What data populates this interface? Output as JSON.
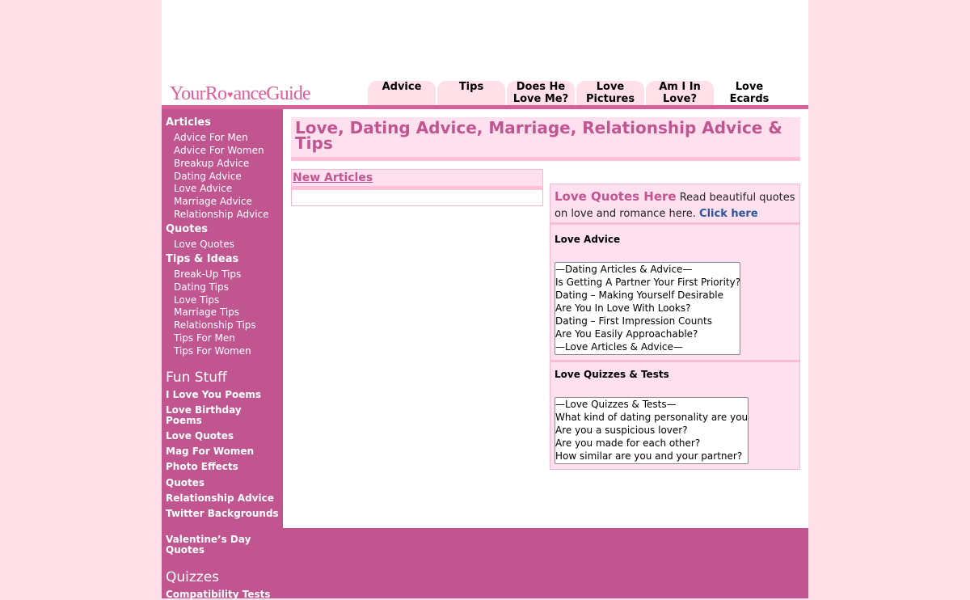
{
  "site": {
    "logo_part1": "YourRomanceGuide",
    "logo_heart": "♥"
  },
  "tabs": [
    {
      "label": "Advice"
    },
    {
      "label": "Tips"
    },
    {
      "label": "Does He Love Me?"
    },
    {
      "label": "Love Pictures"
    },
    {
      "label": "Am I In Love?"
    },
    {
      "label": "Love Ecards"
    }
  ],
  "sidebar": {
    "articles_heading": "Articles",
    "articles": [
      "Advice For Men",
      "Advice For Women",
      "Breakup Advice",
      "Dating Advice",
      "Love Advice",
      "Marriage Advice",
      "Relationship Advice"
    ],
    "quotes_heading": "Quotes",
    "quotes": [
      "Love Quotes"
    ],
    "tips_heading": "Tips & Ideas",
    "tips": [
      "Break-Up Tips",
      "Dating Tips",
      "Love Tips",
      "Marriage Tips",
      "Relationship Tips",
      "Tips For Men",
      "Tips For Women"
    ],
    "fun_heading": "Fun Stuff",
    "fun": [
      "I Love You Poems",
      "Love Birthday Poems",
      "Love Quotes",
      "Mag For Women",
      "Photo Effects",
      "Quotes",
      "Relationship Advice",
      "Twitter Backgrounds",
      "Valentine’s Day Quotes"
    ],
    "quizzes_heading": "Quizzes",
    "quizzes": [
      "Compatibility Tests"
    ]
  },
  "main": {
    "title": "Love, Dating Advice, Marriage, Relationship Advice & Tips",
    "new_articles": "New Articles"
  },
  "right": {
    "quotes_title": "Love Quotes Here",
    "quotes_text": " Read beautiful quotes on love and romance here. ",
    "click_here": "Click here",
    "love_advice_title": "Love Advice",
    "love_advice_options": [
      "—Dating Articles & Advice—",
      "Is Getting A Partner Your First Priority?",
      "Dating – Making Yourself Desirable",
      "Are You In Love With Looks?",
      "Dating – First Impression Counts",
      "Are You Easily Approachable?",
      "—Love Articles & Advice—"
    ],
    "quizzes_title": "Love Quizzes & Tests",
    "quiz_options": [
      "—Love Quizzes & Tests—",
      "What kind of dating personality are you?",
      "Are you a suspicious lover?",
      "Are you made for each other?",
      "How similar are you and your partner?"
    ]
  },
  "colors": {
    "accent": "#c05590",
    "background": "#ffe0e9",
    "link_blue": "#2a5599"
  }
}
